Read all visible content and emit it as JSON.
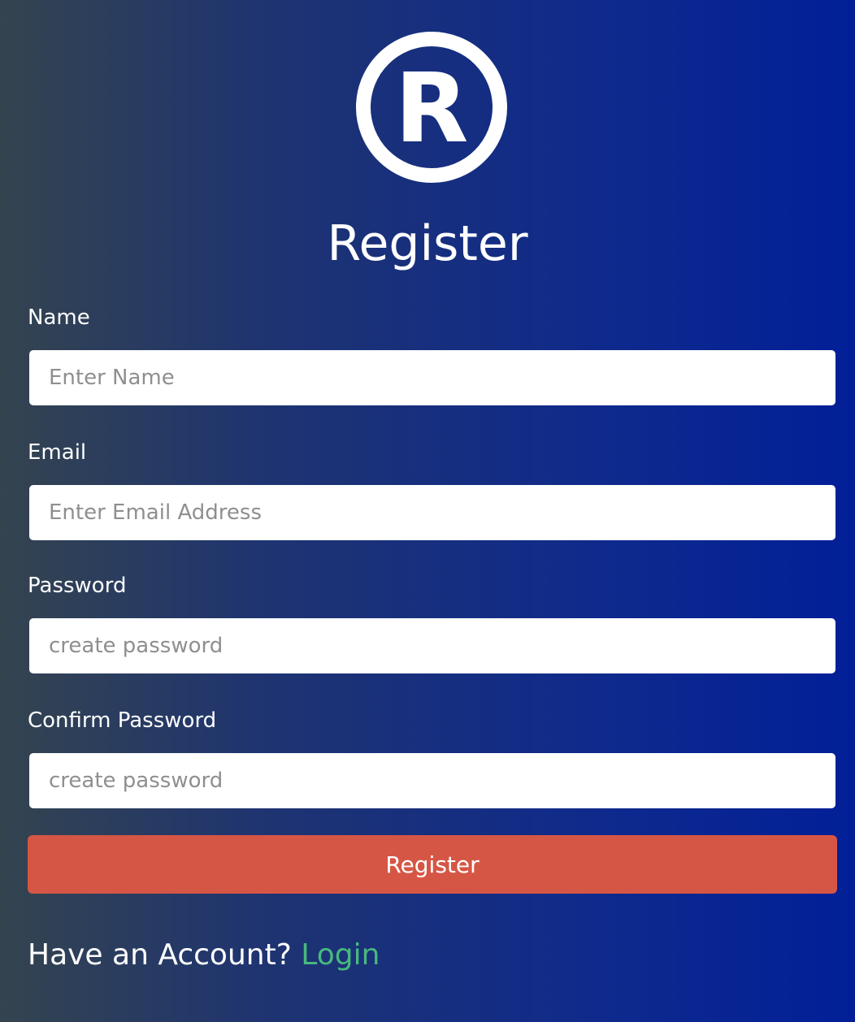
{
  "logo": {
    "icon": "registered-trademark-icon",
    "glyph": "R",
    "color": "#ffffff"
  },
  "page": {
    "title": "Register"
  },
  "form": {
    "fields": [
      {
        "label": "Name",
        "placeholder": "Enter Name",
        "type": "text",
        "value": ""
      },
      {
        "label": "Email",
        "placeholder": "Enter Email Address",
        "type": "email",
        "value": ""
      },
      {
        "label": "Password",
        "placeholder": "create password",
        "type": "password",
        "value": ""
      },
      {
        "label": "Confirm Password",
        "placeholder": "create password",
        "type": "password",
        "value": ""
      }
    ],
    "submit_label": "Register"
  },
  "footer": {
    "prompt": "Have an Account?",
    "link_label": "Login"
  },
  "colors": {
    "background_start": "#34444f",
    "background_end": "#021f98",
    "button": "#d65645",
    "link": "#48b87e",
    "input_bg": "#ffffff"
  }
}
